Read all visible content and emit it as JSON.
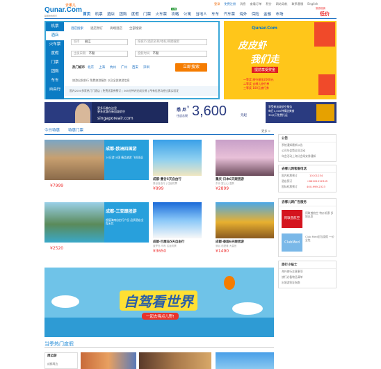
{
  "header": {
    "logo_slogan": "去哪儿",
    "logo_brand": "Qunar.Com",
    "logo_sub": "聪明你的旅行",
    "links": [
      "登录",
      "免费注册",
      "消息",
      "查看订单",
      "积分",
      "网站导航",
      "联系客服",
      "English"
    ],
    "promo_line1": "旅游促销",
    "promo_line2": "低价"
  },
  "nav": {
    "items": [
      "首页",
      "机票",
      "酒店",
      "团购",
      "度假",
      "门票",
      "火车票",
      "攻略",
      "公寓",
      "当地人",
      "车车",
      "汽车票",
      "海外",
      "保险",
      "金融",
      "市场"
    ],
    "badge": "火热"
  },
  "search": {
    "tabs": [
      "机票",
      "酒店",
      "火车票",
      "度假",
      "门票",
      "团购",
      "车车",
      "自由行"
    ],
    "active_tab": "酒店",
    "subtabs": [
      "酒店搜索",
      "酒店预订",
      "高端酒店",
      "全部搜索"
    ],
    "city_label": "城市",
    "city_value": "丽江",
    "keyword_placeholder": "按城市/酒店名称/地标/商圈搜索",
    "checkin_label": "出发日期",
    "checkin_value": "不限",
    "checkout_label": "度假时间",
    "checkout_value": "不限",
    "hot_label": "热门城市",
    "hot_cities": [
      "北京",
      "上海",
      "杭州",
      "广州",
      "西安",
      "深圳"
    ],
    "button": "立即搜索",
    "tip": "旅游出发前行 免费旅游服务 以及全部旅游信息",
    "bar": "国内2000多家热门门酒店 | 免费优惠券预订 | 365分钟内完成交易 | 所有信息均经过真实验证"
  },
  "promo_pipi": {
    "brand": "Qunar.Com",
    "line1": "皮皮虾",
    "line2": "我们走",
    "tag": "提前享受奖金",
    "lines": [
      "一等奖 旅行基金2000元",
      "二等奖 去哪儿旅行券",
      "三等奖 100元旅行券"
    ]
  },
  "sg_banner": {
    "copy": [
      "更多乐趣在这里",
      "更多优惠在新加坡航空",
      "全新体验 从此开始"
    ],
    "url": "singaporeair.com",
    "route": "悉 尼",
    "from_label": "往返含税",
    "currency": "¥",
    "price": "3,600",
    "unit": "元起",
    "bullets": [
      "享受新加坡航空服务",
      "每日1,000种精选美食",
      "30公斤免费托运"
    ]
  },
  "tours_section": {
    "tabs": [
      "今日特惠",
      "特惠门票"
    ],
    "more": "更多 >"
  },
  "tours": [
    {
      "badge": "成都-欧洲四国游",
      "desc": "10日游10国 精品旅游 飞机往返",
      "price": "¥7999",
      "featured": true
    },
    {
      "name": "成都·曼谷5天自由行",
      "desc": "曼谷自由行 | 往返机票",
      "price": "¥999"
    },
    {
      "name": "重庆·日本6天跟团游",
      "desc": "东京 富士山 温泉",
      "price": "¥2899"
    },
    {
      "badge": "成都-三亚跟团游",
      "desc": "超值海南自由行产品 品质酒店全程无忧",
      "price": "¥2520",
      "featured": true
    },
    {
      "name": "成都·巴厘岛5天自由行",
      "desc": "蓝梦岛 乌布 往返机票",
      "price": "¥3650"
    },
    {
      "name": "成都·泰国6天跟团游",
      "desc": "曼谷 芭提雅 大皇宫",
      "price": "¥1490"
    }
  ],
  "sidebar": {
    "notice_title": "公告",
    "notice_lines": [
      "系统通知最新公告",
      "公司年会暨全员活动",
      "年会活动上海分会场安排通知"
    ],
    "contact_title": "去哪儿网客服电话",
    "contact_lines": [
      "国内机票预订",
      "酒店预订",
      "国际机票预订"
    ],
    "phones": [
      "10101234",
      "+86101012345",
      "400-999-2323"
    ],
    "partner_title": "去哪儿网广告服务",
    "partner1": "阿联酋航空",
    "partner1_desc": "阿联酋航空 特价机票 多地出发",
    "partner2": "ClubMed",
    "partner2_desc": "Club Med全包度假 一价全包",
    "tip_title": "旅行小贴士",
    "tip_lines": [
      "海外旅行注意事项",
      "旅行必备物品清单",
      "出境游签证指南"
    ]
  },
  "self_drive": {
    "title": "自驾看世界",
    "sub": "一起去嗨点儿野!"
  },
  "bottom": {
    "hot_title": "当季热门度假",
    "surround_title": "周边游",
    "surround_line": "成都周边"
  },
  "colors": {
    "brand_blue": "#1a6fc2",
    "accent_orange": "#f57c00",
    "price_red": "#e33333"
  }
}
